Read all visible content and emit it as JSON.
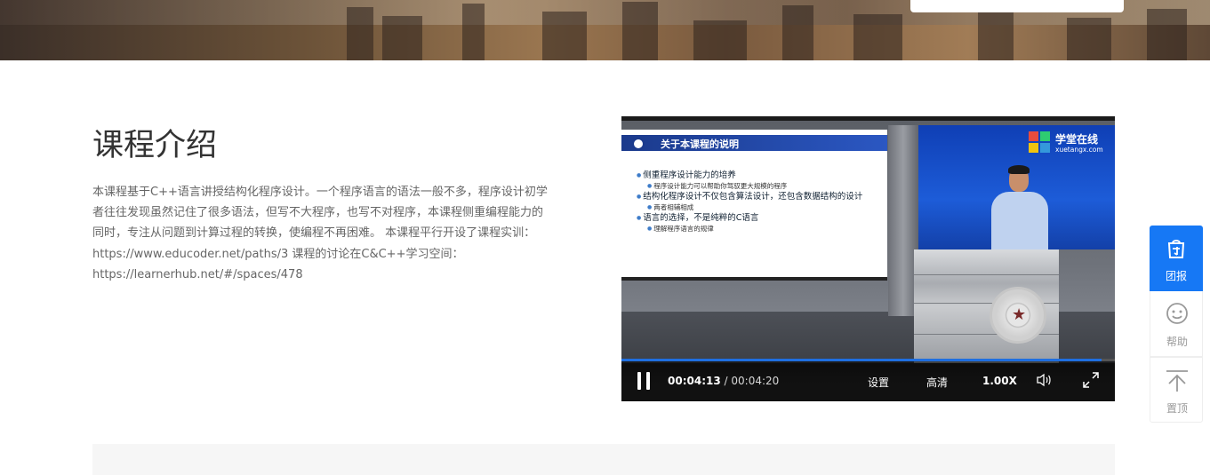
{
  "section": {
    "title": "课程介绍",
    "intro_lines": [
      "本课程基于C++语言讲授结构化程序设计。一个程序语言的语法一般不多，程序设计初学",
      "者往往发现虽然记住了很多语法，但写不大程序，也写不对程序，本课程侧重编程能力的",
      "同时，专注从问题到计算过程的转换，使编程不再困难。 本课程平行开设了课程实训：",
      "https://www.educoder.net/paths/3 课程的讨论在C&C++学习空间：",
      "https://learnerhub.net/#/spaces/478"
    ]
  },
  "video": {
    "slide_title": "关于本课程的说明",
    "bullets": [
      {
        "level": 1,
        "text": "侧重程序设计能力的培养"
      },
      {
        "level": 2,
        "text": "程序设计能力可以帮助你驾驭更大规模的程序"
      },
      {
        "level": 1,
        "text": "结构化程序设计不仅包含算法设计，还包含数据结构的设计"
      },
      {
        "level": 2,
        "text": "两者相辅相成"
      },
      {
        "level": 1,
        "text": "语言的选择，不是纯粹的C语言"
      },
      {
        "level": 2,
        "text": "理解程序语言的规律"
      }
    ],
    "watermark_title": "学堂在线",
    "watermark_sub": "xuetangx.com",
    "current_time": "00:04:13",
    "separator": " / ",
    "duration": "00:04:20",
    "progress_fraction": 0.973,
    "settings_label": "设置",
    "quality_label": "高清",
    "speed_label": "1.00X"
  },
  "sidebar": {
    "items": [
      {
        "label": "团报",
        "icon": "group-buy-icon"
      },
      {
        "label": "帮助",
        "icon": "smiley-help-icon"
      },
      {
        "label": "置顶",
        "icon": "back-to-top-icon"
      }
    ]
  },
  "colors": {
    "accent": "#1678f5",
    "progress": "#1f6fe0",
    "text_primary": "#333333",
    "text_secondary": "#666666"
  }
}
